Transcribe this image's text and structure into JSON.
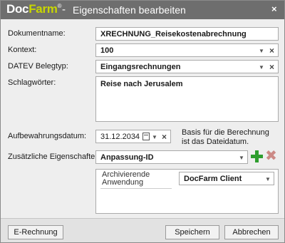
{
  "titlebar": {
    "brand_doc": "Doc",
    "brand_farm": "Farm",
    "brand_reg": "®",
    "separator": "-",
    "title": "Eigenschaften bearbeiten",
    "close_icon": "close-icon",
    "close_glyph": "×"
  },
  "form": {
    "document_name": {
      "label": "Dokumentname:",
      "value": "XRECHNUNG_Reisekostenabrechnung"
    },
    "context": {
      "label": "Kontext:",
      "value": "100"
    },
    "datev": {
      "label": "DATEV Belegtyp:",
      "value": "Eingangsrechnungen"
    },
    "keywords": {
      "label": "Schlagwörter:",
      "value": "Reise nach Jerusalem"
    },
    "retention": {
      "label": "Aufbewahrungsdatum:",
      "value": "31.12.2034",
      "hint": "Basis für die Berechnung ist das Dateidatum."
    },
    "additional": {
      "label": "Zusätzliche Eigenschaften:",
      "value": "Anpassung-ID",
      "add_icon": "plus-icon",
      "remove_icon": "remove-icon",
      "remove_glyph": "✖"
    },
    "archiving_app": {
      "label": "Archivierende Anwendung",
      "value": "DocFarm Client"
    },
    "glyphs": {
      "dropdown": "▼",
      "clear": "×"
    }
  },
  "footer": {
    "erechnung": "E-Rechnung",
    "save": "Speichern",
    "cancel": "Abbrechen"
  }
}
